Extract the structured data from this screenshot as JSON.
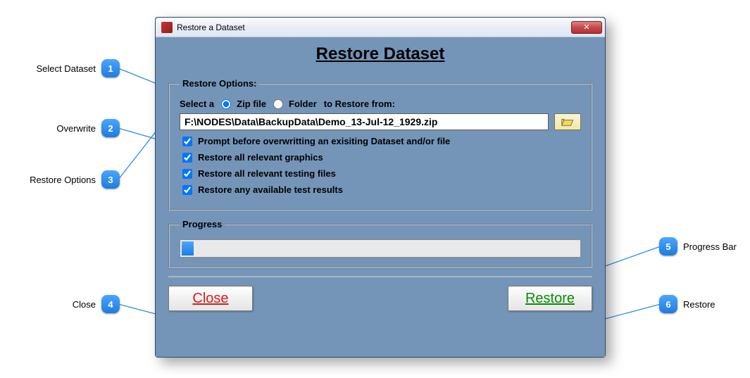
{
  "window": {
    "title": "Restore a Dataset",
    "main_heading": "Restore Dataset"
  },
  "restore_options": {
    "legend": "Restore Options:",
    "select_prefix": "Select a",
    "radio_zip": "Zip file",
    "radio_folder": "Folder",
    "select_suffix": "to Restore from:",
    "selected_source": "zip",
    "path": "F:\\NODES\\Data\\BackupData\\Demo_13-Jul-12_1929.zip",
    "checks": {
      "prompt": {
        "label": "Prompt before overwritting an exisiting Dataset and/or file",
        "checked": true
      },
      "graphics": {
        "label": "Restore all relevant graphics",
        "checked": true
      },
      "testing": {
        "label": "Restore all relevant testing files",
        "checked": true
      },
      "results": {
        "label": "Restore any available test results",
        "checked": true
      }
    }
  },
  "progress": {
    "legend": "Progress",
    "percent": 3
  },
  "buttons": {
    "close": "Close",
    "restore": "Restore"
  },
  "annotations": {
    "a1": {
      "n": "1",
      "label": "Select Dataset"
    },
    "a2": {
      "n": "2",
      "label": "Overwrite"
    },
    "a3": {
      "n": "3",
      "label": "Restore Options"
    },
    "a4": {
      "n": "4",
      "label": "Close"
    },
    "a5": {
      "n": "5",
      "label": "Progress Bar"
    },
    "a6": {
      "n": "6",
      "label": "Restore"
    }
  }
}
